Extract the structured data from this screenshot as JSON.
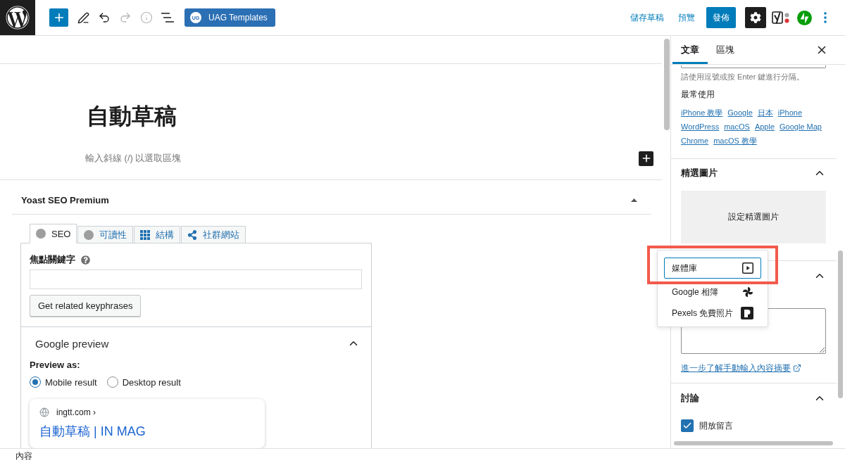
{
  "top_bar": {
    "tools": [
      {
        "kind": "inserter",
        "disabled": false
      },
      {
        "kind": "tools",
        "disabled": false
      },
      {
        "kind": "undo",
        "disabled": false
      },
      {
        "kind": "redo",
        "disabled": true
      },
      {
        "kind": "details",
        "disabled": true
      },
      {
        "kind": "list_view",
        "disabled": false
      }
    ],
    "template_button": {
      "badge": "UG",
      "label": "UAG Templates"
    },
    "save_draft": "儲存草稿",
    "preview": "預覽",
    "publish": "發佈",
    "settings_active": true
  },
  "editor": {
    "title": "自動草稿",
    "block_placeholder": "輸入斜線 (/) 以選取區塊"
  },
  "seo_box": {
    "title": "Yoast SEO Premium",
    "expanded": true,
    "tabs": [
      {
        "kind": "score",
        "label": "SEO",
        "selected": true
      },
      {
        "kind": "score",
        "label": "可讀性",
        "selected": false
      },
      {
        "kind": "schema",
        "label": "結構",
        "selected": false
      },
      {
        "kind": "social",
        "label": "社群網站",
        "selected": false
      }
    ],
    "focus_keyphrase": {
      "label": "焦點關鍵字"
    },
    "related_button": "Get related keyphrases",
    "google_preview": {
      "title": "Google preview",
      "expanded": true,
      "preview_as": "Preview as:",
      "options": [
        {
          "label": "Mobile result",
          "selected": true
        },
        {
          "label": "Desktop result",
          "selected": false
        }
      ],
      "result": {
        "url": "ingtt.com ›",
        "title": "自動草稿 | IN MAG"
      }
    }
  },
  "sidebar": {
    "tabs": [
      {
        "label": "文章",
        "selected": true
      },
      {
        "label": "區塊",
        "selected": false
      }
    ],
    "tags": {
      "hint": "請使用逗號或按 Enter 鍵進行分隔。",
      "most_used_title": "最常使用",
      "most_used": [
        "iPhone 教學",
        "Google",
        "日本",
        "iPhone",
        "WordPress",
        "macOS",
        "Apple",
        "Google Map",
        "Chrome",
        "macOS 教學"
      ]
    },
    "featured_image": {
      "title": "精選圖片",
      "expanded": true,
      "button": "設定精選圖片"
    },
    "excerpt": {
      "expanded": true,
      "link": "進一步了解手動輸入內容摘要"
    },
    "discussion": {
      "title": "討論",
      "expanded": true,
      "options": [
        {
          "label": "開放留言",
          "checked": true
        }
      ]
    }
  },
  "media_menu": {
    "items": [
      {
        "kind": "media_library",
        "label": "媒體庫",
        "selected": true
      },
      {
        "kind": "google_photos",
        "label": "Google 相簿",
        "selected": false
      },
      {
        "kind": "pexels",
        "label": "Pexels 免費照片",
        "selected": false
      }
    ]
  },
  "footer": {
    "breadcrumb": "內容"
  }
}
